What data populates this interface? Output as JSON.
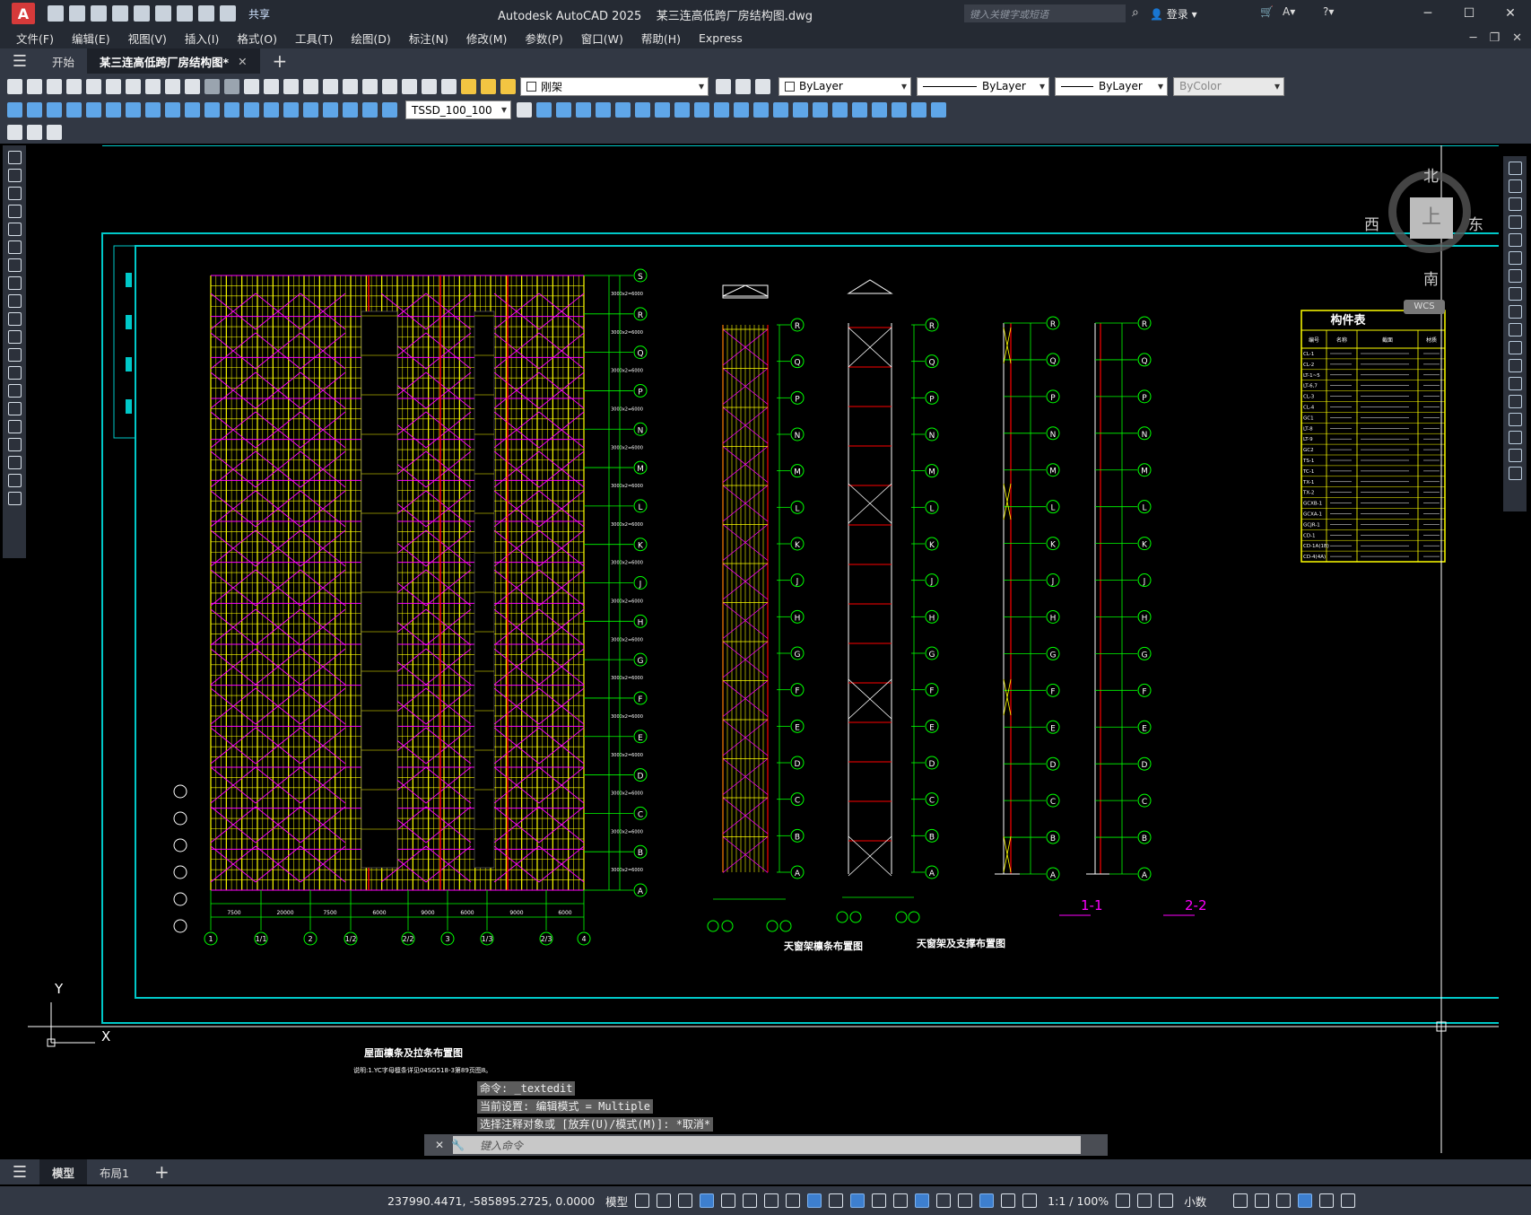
{
  "app": {
    "title": "Autodesk AutoCAD 2025",
    "filename": "某三连高低跨厂房结构图.dwg",
    "share_label": "共享",
    "search_placeholder": "键入关键字或短语",
    "login_label": "登录"
  },
  "menu": [
    "文件(F)",
    "编辑(E)",
    "视图(V)",
    "插入(I)",
    "格式(O)",
    "工具(T)",
    "绘图(D)",
    "标注(N)",
    "修改(M)",
    "参数(P)",
    "窗口(W)",
    "帮助(H)",
    "Express"
  ],
  "tabs": {
    "start": "开始",
    "doc": "某三连高低跨厂房结构图*"
  },
  "toolbar": {
    "layer": "刚架",
    "color": "ByLayer",
    "linetype": "ByLayer",
    "lineweight": "ByLayer",
    "plotstyle": "ByColor",
    "textstyle": "TSSD_100_100"
  },
  "viewcube": {
    "north": "北",
    "south": "南",
    "east": "东",
    "west": "西",
    "top": "上",
    "wcs": "WCS"
  },
  "drawing": {
    "roof_plan_title": "屋面檩条及拉条布置图",
    "roof_plan_note": "说明:1.YC字母檩条详见04SG518-3第89页图8。",
    "skylight_purlin_title": "天窗架檩条布置图",
    "skylight_brace_title": "天窗架及支撑布置图",
    "section_1": "1-1",
    "section_2": "2-2",
    "grid_letters": [
      "S",
      "R",
      "Q",
      "P",
      "N",
      "M",
      "L",
      "K",
      "J",
      "H",
      "G",
      "F",
      "E",
      "D",
      "C",
      "B",
      "A"
    ],
    "grid_numbers": [
      "1",
      "1/1",
      "2",
      "1/2",
      "2/2",
      "3",
      "1/3",
      "2/3",
      "4"
    ],
    "bay_dims": [
      "7500",
      "20000",
      "7500",
      "6000",
      "9000",
      "6000",
      "9000",
      "6000"
    ],
    "table_title": "构件表",
    "table_headers": [
      "编号",
      "名称",
      "截面",
      "材质"
    ],
    "table_rows": [
      "CL-1",
      "CL-2",
      "LT-1~5",
      "LT-6,7",
      "CL-3",
      "CL-4",
      "GC1",
      "LT-8",
      "LT-9",
      "GC2",
      "TS-1",
      "TC-1",
      "TX-1",
      "TX-2",
      "GCXB-1",
      "GCXA-1",
      "GCJR-1",
      "CD-1",
      "CD-1A(1B)",
      "CD-4(4A)"
    ]
  },
  "axis": {
    "y": "Y",
    "x": "X"
  },
  "command": {
    "history": [
      "命令: _textedit",
      "当前设置: 编辑模式 = Multiple",
      "选择注释对象或 [放弃(U)/模式(M)]: *取消*"
    ],
    "placeholder": "键入命令"
  },
  "layouts": {
    "model": "模型",
    "layout1": "布局1"
  },
  "status": {
    "coords": "237990.4471, -585895.2725, 0.0000",
    "model": "模型",
    "scale": "1:1 / 100%",
    "units": "小数"
  },
  "colors": {
    "background": "#000000",
    "frame": "#00c8c8",
    "grid": "#00ff00",
    "beam": "#ffff00",
    "brace": "#ff00ff",
    "column": "#ff0000"
  }
}
